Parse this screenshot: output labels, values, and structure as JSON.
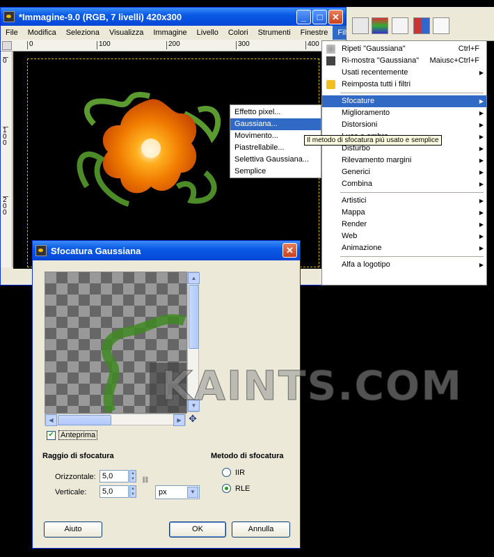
{
  "main_window": {
    "title": "*Immagine-9.0 (RGB, 7 livelli) 420x300",
    "menubar": [
      "File",
      "Modifica",
      "Seleziona",
      "Visualizza",
      "Immagine",
      "Livello",
      "Colori",
      "Strumenti",
      "Finestre",
      "Filtri"
    ],
    "ruler_top": [
      "0",
      "100",
      "200",
      "300",
      "400"
    ],
    "ruler_left": [
      "0",
      "100",
      "200"
    ]
  },
  "filters_menu": {
    "items": [
      {
        "label": "Ripeti \"Gaussiana\"",
        "shortcut": "Ctrl+F",
        "icon": "repeat-icon"
      },
      {
        "label": "Ri-mostra \"Gaussiana\"",
        "shortcut": "Maiusc+Ctrl+F",
        "icon": "reshow-icon"
      },
      {
        "label": "Usati recentemente",
        "submenu": true
      },
      {
        "label": "Reimposta tutti i filtri",
        "icon": "reset-icon"
      }
    ],
    "group2": [
      "Sfocature",
      "Miglioramento",
      "Distorsioni",
      "Luce e ombra",
      "Disturbo",
      "Rilevamento margini",
      "Generici",
      "Combina"
    ],
    "group3": [
      "Artistici",
      "Mappa",
      "Render",
      "Web",
      "Animazione"
    ],
    "group4": [
      "Alfa a logotipo"
    ]
  },
  "blur_submenu": {
    "items": [
      "Effetto pixel...",
      "Gaussiana...",
      "Movimento...",
      "Piastrellabile...",
      "Selettiva Gaussiana...",
      "Semplice"
    ],
    "tooltip": "Il metodo di sfocatura più usato e semplice"
  },
  "dialog": {
    "title": "Sfocatura Gaussiana",
    "preview_label": "Anteprima",
    "preview_checked": true,
    "radius_title": "Raggio di sfocatura",
    "horizontal_label": "Orizzontale:",
    "horizontal_value": "5,0",
    "vertical_label": "Verticale:",
    "vertical_value": "5,0",
    "unit": "px",
    "method_title": "Metodo di sfocatura",
    "method_options": [
      "IIR",
      "RLE"
    ],
    "method_selected": "RLE",
    "buttons": {
      "help": "Aiuto",
      "ok": "OK",
      "cancel": "Annulla"
    }
  },
  "watermark": "KAINTS.COM",
  "colors": {
    "xp_blue": "#0a5be6",
    "menu_highlight": "#316ac5",
    "window_bg": "#ece9d8"
  }
}
